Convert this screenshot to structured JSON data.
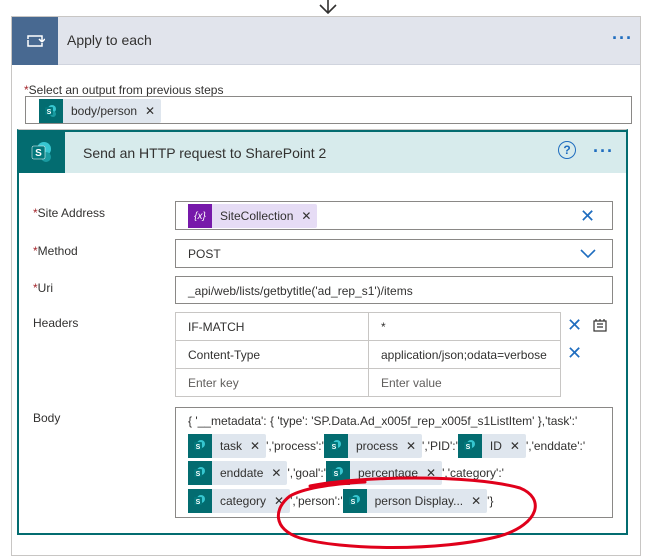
{
  "apply_to_each": {
    "title": "Apply to each",
    "more": "···",
    "select_label": "Select an output from previous steps",
    "select_token": "body/person"
  },
  "http_action": {
    "title": "Send an HTTP request to SharePoint 2",
    "help": "?",
    "more": "···",
    "site_address": {
      "label": "Site Address",
      "token": "SiteCollection",
      "token_icon": "{x}"
    },
    "method": {
      "label": "Method",
      "value": "POST"
    },
    "uri": {
      "label": "Uri",
      "value": "_api/web/lists/getbytitle('ad_rep_s1')/items"
    },
    "headers": {
      "label": "Headers",
      "rows": [
        {
          "key": "IF-MATCH",
          "value": "*"
        },
        {
          "key": "Content-Type",
          "value": "application/json;odata=verbose"
        }
      ],
      "key_placeholder": "Enter key",
      "value_placeholder": "Enter value"
    },
    "body": {
      "label": "Body",
      "line1": "{ '__metadata': { 'type': 'SP.Data.Ad_x005f_rep_x005f_s1ListItem' },'task':'",
      "tokens": {
        "task": "task",
        "process": "process",
        "id": "ID",
        "enddate": "enddate",
        "percentage": "percentage",
        "category": "category",
        "person": "person Display..."
      },
      "sep_process": "','process':'",
      "sep_pid": "','PID':'",
      "sep_enddate": "','enddate':'",
      "sep_goal": "','goal':'",
      "sep_category": "','category':'",
      "sep_person": "','person':'",
      "sep_end": "'}"
    }
  },
  "colors": {
    "sharepoint": "#036c70",
    "accent": "#1f6dbf",
    "annotation": "#e0001b"
  }
}
